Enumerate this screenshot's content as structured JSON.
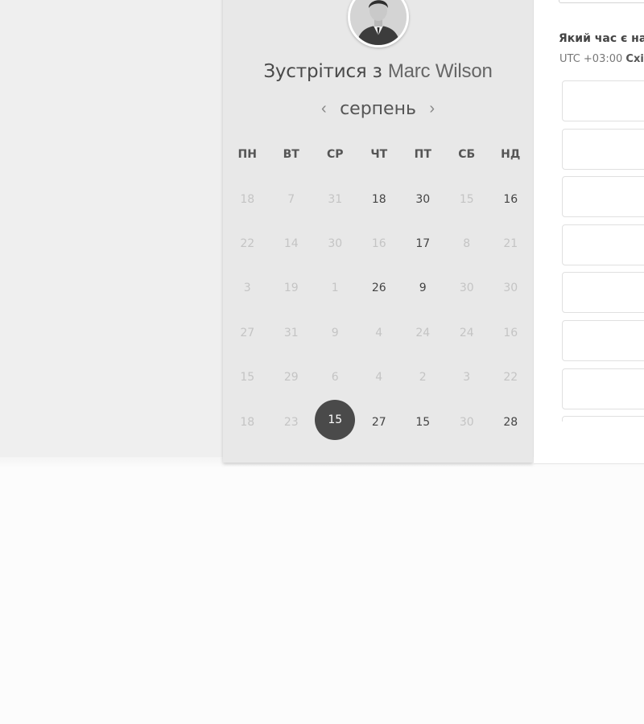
{
  "host": {
    "meet_prefix": "Зустрітися з",
    "name": "Marc Wilson",
    "avatar_icon": "person-photo-avatar"
  },
  "calendar": {
    "month": "серпень",
    "prev_icon": "chevron-left-icon",
    "next_icon": "chevron-right-icon",
    "prev_glyph": "‹",
    "next_glyph": "›",
    "weekdays": [
      "ПН",
      "ВТ",
      "СР",
      "ЧТ",
      "ПТ",
      "СБ",
      "НД"
    ],
    "selected_day": "15",
    "weeks": [
      [
        {
          "d": "18",
          "a": false
        },
        {
          "d": "7",
          "a": false
        },
        {
          "d": "31",
          "a": false
        },
        {
          "d": "18",
          "a": true
        },
        {
          "d": "30",
          "a": true
        },
        {
          "d": "15",
          "a": false
        },
        {
          "d": "16",
          "a": true
        }
      ],
      [
        {
          "d": "22",
          "a": false
        },
        {
          "d": "14",
          "a": false
        },
        {
          "d": "30",
          "a": false
        },
        {
          "d": "16",
          "a": false
        },
        {
          "d": "17",
          "a": true
        },
        {
          "d": "8",
          "a": false
        },
        {
          "d": "21",
          "a": false
        }
      ],
      [
        {
          "d": "3",
          "a": false
        },
        {
          "d": "19",
          "a": false
        },
        {
          "d": "1",
          "a": false
        },
        {
          "d": "26",
          "a": true
        },
        {
          "d": "9",
          "a": true
        },
        {
          "d": "30",
          "a": false
        },
        {
          "d": "30",
          "a": false
        }
      ],
      [
        {
          "d": "27",
          "a": false
        },
        {
          "d": "31",
          "a": false
        },
        {
          "d": "9",
          "a": false
        },
        {
          "d": "4",
          "a": false
        },
        {
          "d": "24",
          "a": false
        },
        {
          "d": "24",
          "a": false
        },
        {
          "d": "16",
          "a": false
        }
      ],
      [
        {
          "d": "15",
          "a": false
        },
        {
          "d": "29",
          "a": false
        },
        {
          "d": "6",
          "a": false
        },
        {
          "d": "4",
          "a": false
        },
        {
          "d": "2",
          "a": false
        },
        {
          "d": "3",
          "a": false
        },
        {
          "d": "22",
          "a": false
        }
      ],
      [
        {
          "d": "18",
          "a": false
        },
        {
          "d": "23",
          "a": false
        },
        {
          "d": "15",
          "a": true,
          "selected": true
        },
        {
          "d": "27",
          "a": true
        },
        {
          "d": "15",
          "a": true
        },
        {
          "d": "30",
          "a": false
        },
        {
          "d": "28",
          "a": true
        }
      ]
    ]
  },
  "time_panel": {
    "question": "Який час є на",
    "tz_offset": "UTC +03:00",
    "tz_name": "Схід",
    "slots": [
      "",
      "",
      "",
      "",
      "",
      "",
      "",
      ""
    ]
  },
  "colors": {
    "selected_day_bg": "#4a4a4a",
    "available_day": "#444444",
    "unavailable_day": "#c4c4c4",
    "card_bg": "#e8e8e8"
  }
}
